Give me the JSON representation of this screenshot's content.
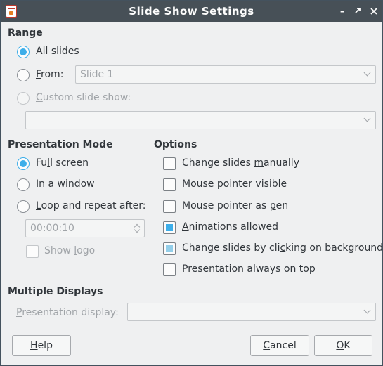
{
  "window": {
    "title": "Slide Show Settings"
  },
  "range": {
    "heading": "Range",
    "all_slides": {
      "pre": "All ",
      "acc": "s",
      "post": "lides",
      "checked": true
    },
    "from": {
      "pre": "",
      "acc": "F",
      "post": "rom:",
      "value": "Slide 1"
    },
    "custom": {
      "pre": "",
      "acc": "C",
      "post": "ustom slide show:",
      "value": ""
    }
  },
  "mode": {
    "heading": "Presentation Mode",
    "full_screen": {
      "pre": "Fu",
      "acc": "l",
      "post": "l screen",
      "checked": true
    },
    "in_window": {
      "pre": "In a ",
      "acc": "w",
      "post": "indow"
    },
    "loop": {
      "pre": "",
      "acc": "L",
      "post": "oop and repeat after:"
    },
    "loop_time": "00:00:10",
    "show_logo": {
      "pre": "Show ",
      "acc": "l",
      "post": "ogo"
    }
  },
  "options": {
    "heading": "Options",
    "items": [
      {
        "pre": "Change slides ",
        "acc": "m",
        "post": "anually",
        "checked": false,
        "dim": false
      },
      {
        "pre": "Mouse pointer ",
        "acc": "v",
        "post": "isible",
        "checked": false,
        "dim": false
      },
      {
        "pre": "Mouse pointer as ",
        "acc": "p",
        "post": "en",
        "checked": false,
        "dim": false
      },
      {
        "pre": "",
        "acc": "A",
        "post": "nimations allowed",
        "checked": true,
        "dim": false
      },
      {
        "pre": "Change slides by cli",
        "acc": "c",
        "post": "king on background",
        "checked": true,
        "dim": true
      },
      {
        "pre": "Presentation always ",
        "acc": "o",
        "post": "n top",
        "checked": false,
        "dim": false
      }
    ]
  },
  "displays": {
    "heading": "Multiple Displays",
    "label": {
      "pre": "",
      "acc": "P",
      "post": "resentation display:"
    },
    "value": ""
  },
  "buttons": {
    "help": {
      "pre": "",
      "acc": "H",
      "post": "elp"
    },
    "cancel": {
      "pre": "",
      "acc": "C",
      "post": "ancel"
    },
    "ok": {
      "pre": "",
      "acc": "O",
      "post": "K"
    }
  },
  "colors": {
    "accent": "#3daee9",
    "titlebar": "#475057",
    "background": "#eff0f1"
  },
  "icons": {
    "app": "impress-app-icon",
    "minimize": "minimize-icon",
    "restore": "restore-icon",
    "close": "close-icon"
  }
}
